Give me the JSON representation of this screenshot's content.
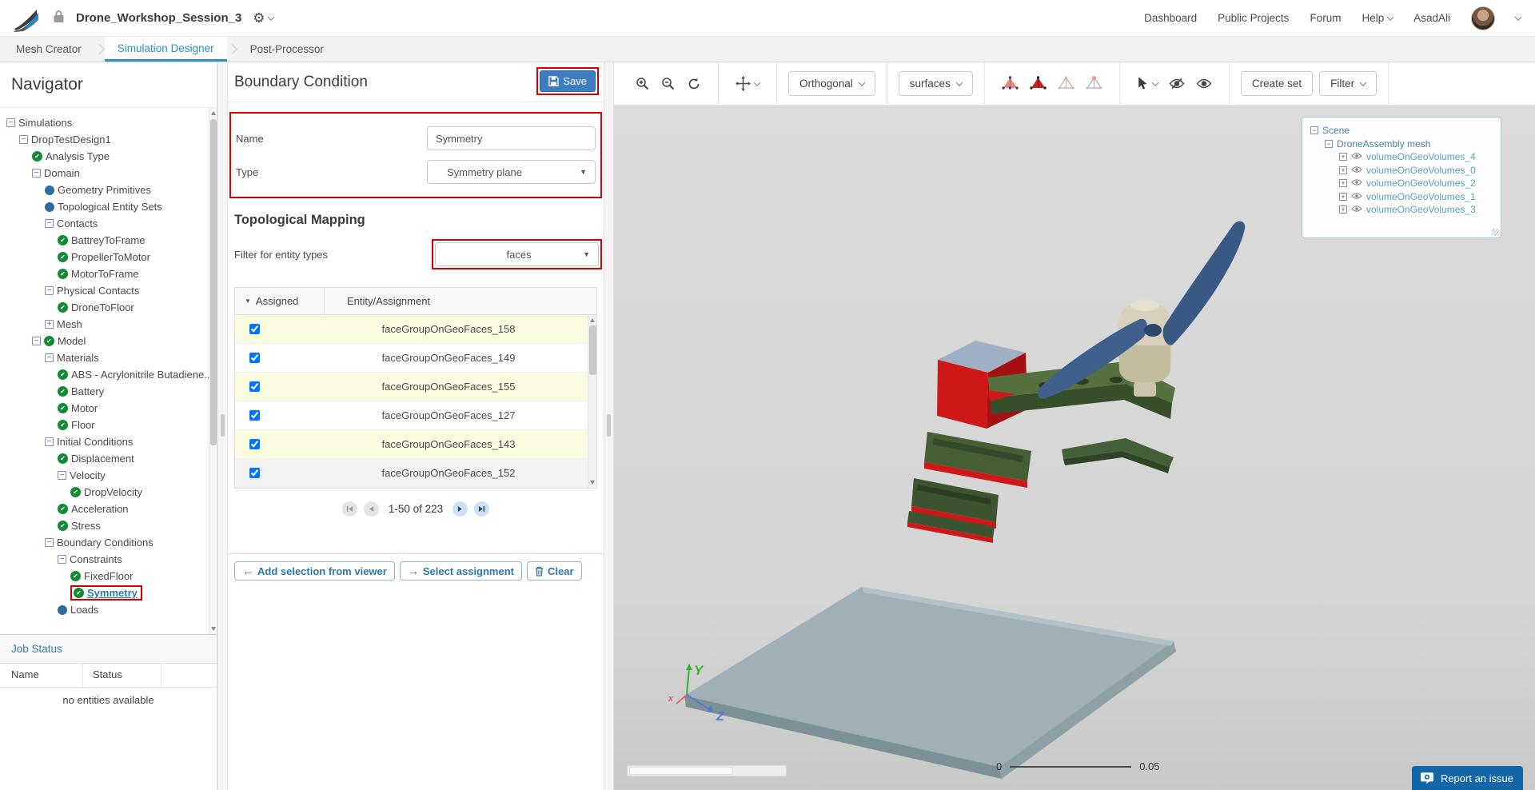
{
  "header": {
    "title": "Drone_Workshop_Session_3",
    "nav": [
      {
        "label": "Dashboard",
        "chev": false
      },
      {
        "label": "Public Projects",
        "chev": false
      },
      {
        "label": "Forum",
        "chev": false
      },
      {
        "label": "Help",
        "chev": true
      },
      {
        "label": "AsadAli",
        "chev": false
      }
    ]
  },
  "tabs": [
    {
      "label": "Mesh Creator",
      "active": false
    },
    {
      "label": "Simulation Designer",
      "active": true
    },
    {
      "label": "Post-Processor",
      "active": false
    }
  ],
  "navigator": {
    "title": "Navigator",
    "items": [
      {
        "label": "Simulations",
        "level": 0,
        "icons": [
          "minus"
        ]
      },
      {
        "label": "DropTestDesign1",
        "level": 1,
        "icons": [
          "minus"
        ]
      },
      {
        "label": "Analysis Type",
        "level": 2,
        "icons": [
          "check"
        ]
      },
      {
        "label": "Domain",
        "level": 2,
        "icons": [
          "minus"
        ]
      },
      {
        "label": "Geometry Primitives",
        "level": 3,
        "icons": [
          "dot"
        ]
      },
      {
        "label": "Topological Entity Sets",
        "level": 3,
        "icons": [
          "dot"
        ]
      },
      {
        "label": "Contacts",
        "level": 3,
        "icons": [
          "minus"
        ]
      },
      {
        "label": "BattreyToFrame",
        "level": 4,
        "icons": [
          "check"
        ]
      },
      {
        "label": "PropellerToMotor",
        "level": 4,
        "icons": [
          "check"
        ]
      },
      {
        "label": "MotorToFrame",
        "level": 4,
        "icons": [
          "check"
        ]
      },
      {
        "label": "Physical Contacts",
        "level": 3,
        "icons": [
          "minus"
        ]
      },
      {
        "label": "DroneToFloor",
        "level": 4,
        "icons": [
          "check"
        ]
      },
      {
        "label": "Mesh",
        "level": 3,
        "icons": [
          "plus"
        ]
      },
      {
        "label": "Model",
        "level": 2,
        "icons": [
          "minus",
          "check"
        ]
      },
      {
        "label": "Materials",
        "level": 3,
        "icons": [
          "minus"
        ]
      },
      {
        "label": "ABS - Acrylonitrile Butadiene...",
        "level": 4,
        "icons": [
          "check"
        ]
      },
      {
        "label": "Battery",
        "level": 4,
        "icons": [
          "check"
        ]
      },
      {
        "label": "Motor",
        "level": 4,
        "icons": [
          "check"
        ]
      },
      {
        "label": "Floor",
        "level": 4,
        "icons": [
          "check"
        ]
      },
      {
        "label": "Initial Conditions",
        "level": 3,
        "icons": [
          "minus"
        ]
      },
      {
        "label": "Displacement",
        "level": 4,
        "icons": [
          "check"
        ]
      },
      {
        "label": "Velocity",
        "level": 4,
        "icons": [
          "minus"
        ]
      },
      {
        "label": "DropVelocity",
        "level": 5,
        "icons": [
          "check"
        ]
      },
      {
        "label": "Acceleration",
        "level": 4,
        "icons": [
          "check"
        ]
      },
      {
        "label": "Stress",
        "level": 4,
        "icons": [
          "check"
        ]
      },
      {
        "label": "Boundary Conditions",
        "level": 3,
        "icons": [
          "minus"
        ]
      },
      {
        "label": "Constraints",
        "level": 4,
        "icons": [
          "minus"
        ]
      },
      {
        "label": "FixedFloor",
        "level": 5,
        "icons": [
          "check"
        ]
      },
      {
        "label": "Symmetry",
        "level": 5,
        "icons": [
          "check"
        ],
        "selected": true
      },
      {
        "label": "Loads",
        "level": 4,
        "icons": [
          "dot"
        ]
      }
    ]
  },
  "job_status": {
    "title": "Job Status",
    "columns": [
      "Name",
      "Status"
    ],
    "empty": "no entities available"
  },
  "panel": {
    "title": "Boundary Condition",
    "save_label": "Save",
    "fields": {
      "name_label": "Name",
      "name_value": "Symmetry",
      "type_label": "Type",
      "type_value": "Symmetry plane"
    },
    "section": "Topological Mapping",
    "filter_label": "Filter for entity types",
    "filter_value": "faces",
    "table": {
      "columns": [
        "Assigned",
        "Entity/Assignment"
      ],
      "rows": [
        {
          "checked": true,
          "entity": "faceGroupOnGeoFaces_158"
        },
        {
          "checked": true,
          "entity": "faceGroupOnGeoFaces_149"
        },
        {
          "checked": true,
          "entity": "faceGroupOnGeoFaces_155"
        },
        {
          "checked": true,
          "entity": "faceGroupOnGeoFaces_127"
        },
        {
          "checked": true,
          "entity": "faceGroupOnGeoFaces_143"
        },
        {
          "checked": true,
          "entity": "faceGroupOnGeoFaces_152"
        }
      ]
    },
    "pagination": "1-50 of 223",
    "actions": [
      {
        "label": "Add selection from viewer",
        "icon": "arrow-left"
      },
      {
        "label": "Select assignment",
        "icon": "arrow-right"
      },
      {
        "label": "Clear",
        "icon": "trash"
      }
    ]
  },
  "viewer": {
    "toolbar": {
      "view_mode": "Orthogonal",
      "render_mode": "surfaces",
      "create_set": "Create set",
      "filter": "Filter"
    },
    "scene_tree": [
      {
        "label": "Scene",
        "level": 0,
        "expander": "minus",
        "eye": false,
        "kind": "parent"
      },
      {
        "label": "DroneAssembly mesh",
        "level": 1,
        "expander": "minus",
        "eye": false,
        "kind": "parent"
      },
      {
        "label": "volumeOnGeoVolumes_4",
        "level": 2,
        "expander": "plus",
        "eye": true,
        "kind": "vol"
      },
      {
        "label": "volumeOnGeoVolumes_0",
        "level": 2,
        "expander": "plus",
        "eye": true,
        "kind": "vol"
      },
      {
        "label": "volumeOnGeoVolumes_2",
        "level": 2,
        "expander": "plus",
        "eye": true,
        "kind": "vol"
      },
      {
        "label": "volumeOnGeoVolumes_1",
        "level": 2,
        "expander": "plus",
        "eye": true,
        "kind": "vol"
      },
      {
        "label": "volumeOnGeoVolumes_3",
        "level": 2,
        "expander": "plus",
        "eye": true,
        "kind": "vol"
      }
    ],
    "scale": {
      "min": "0",
      "max": "0.05"
    },
    "axes": [
      "Y",
      "Z",
      "x"
    ],
    "report_label": "Report an issue"
  },
  "colors": {
    "accent_blue": "#2d8fc4",
    "save_blue": "#3d7ec0",
    "highlight_red": "#d40000",
    "check_green": "#148a36",
    "assigned_row_yellow": "#fbfbdf",
    "report_blue": "#1366a7",
    "selection_red": "#cf1717",
    "frame_green": "#4f6b40",
    "propeller_blue": "#3a5a85",
    "floor_gray": "#9fb1b6"
  }
}
